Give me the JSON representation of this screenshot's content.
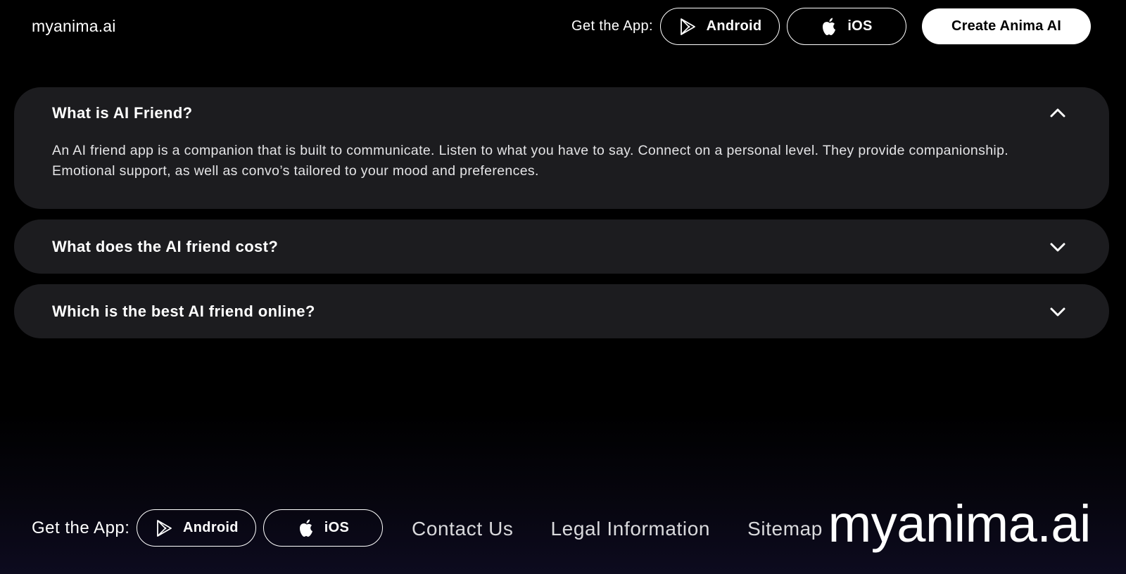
{
  "header": {
    "logo": "myanima.ai",
    "get_app_label": "Get the App:",
    "android_label": "Android",
    "ios_label": "iOS",
    "create_label": "Create Anima AI"
  },
  "faq": {
    "items": [
      {
        "question": "What is AI Friend?",
        "answer": "An AI friend app is a companion that is built to communicate. Listen to what you have to say. Connect on a personal level. They provide companionship. Emotional support, as well as convo’s tailored to your mood and preferences.",
        "expanded": true,
        "icon": "chevron-up-icon"
      },
      {
        "question": "What does the AI friend cost?",
        "expanded": false,
        "icon": "chevron-down-icon"
      },
      {
        "question": "Which is the best AI friend online?",
        "expanded": false,
        "icon": "chevron-down-icon"
      }
    ]
  },
  "footer": {
    "get_app_label": "Get the App:",
    "android_label": "Android",
    "ios_label": "iOS",
    "links": [
      "Contact Us",
      "Legal Information",
      "Sitemap"
    ],
    "logo": "myanima.ai"
  },
  "colors": {
    "background": "#000000",
    "card": "#1c1c1f",
    "primary_button_bg": "#ffffff",
    "primary_button_text": "#000000"
  }
}
